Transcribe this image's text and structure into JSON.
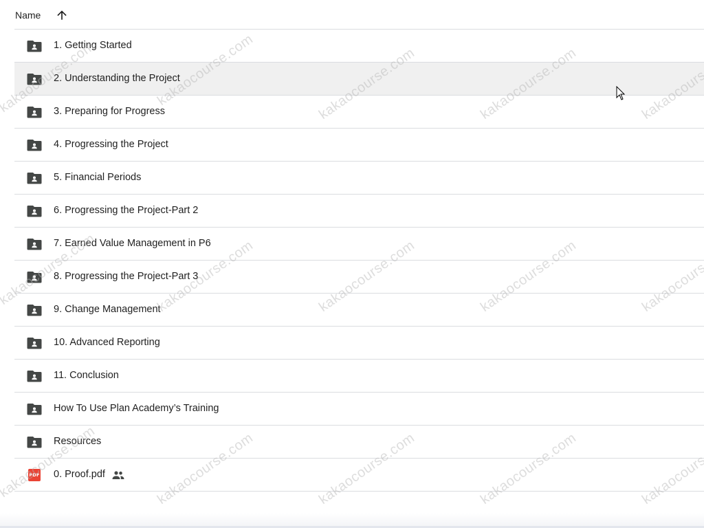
{
  "header": {
    "name_label": "Name",
    "sort_icon": "arrow-up-icon"
  },
  "files": [
    {
      "name": "1. Getting Started",
      "type": "shared-folder",
      "icon": "shared-folder-icon"
    },
    {
      "name": "2. Understanding the Project",
      "type": "shared-folder",
      "icon": "shared-folder-icon",
      "selected": true
    },
    {
      "name": "3. Preparing for Progress",
      "type": "shared-folder",
      "icon": "shared-folder-icon"
    },
    {
      "name": "4. Progressing the Project",
      "type": "shared-folder",
      "icon": "shared-folder-icon"
    },
    {
      "name": "5. Financial Periods",
      "type": "shared-folder",
      "icon": "shared-folder-icon"
    },
    {
      "name": "6. Progressing the Project-Part 2",
      "type": "shared-folder",
      "icon": "shared-folder-icon"
    },
    {
      "name": "7. Earned Value Management in P6",
      "type": "shared-folder",
      "icon": "shared-folder-icon"
    },
    {
      "name": "8. Progressing the Project-Part 3",
      "type": "shared-folder",
      "icon": "shared-folder-icon"
    },
    {
      "name": "9. Change Management",
      "type": "shared-folder",
      "icon": "shared-folder-icon"
    },
    {
      "name": "10. Advanced Reporting",
      "type": "shared-folder",
      "icon": "shared-folder-icon"
    },
    {
      "name": "11. Conclusion",
      "type": "shared-folder",
      "icon": "shared-folder-icon"
    },
    {
      "name": "How To Use Plan Academy’s Training",
      "type": "shared-folder",
      "icon": "shared-folder-icon"
    },
    {
      "name": "Resources",
      "type": "shared-folder",
      "icon": "shared-folder-icon"
    },
    {
      "name": "0. Proof.pdf",
      "type": "pdf",
      "icon": "pdf-icon",
      "icon_text": "PDF",
      "shared_icon": "people-icon"
    }
  ],
  "watermark": "kakaocourse.com",
  "colors": {
    "text": "#1f1f1f",
    "folder_icon": "#444746",
    "divider": "#dadce0",
    "selected_row": "#f0f0f0",
    "pdf_red": "#ea4335"
  }
}
